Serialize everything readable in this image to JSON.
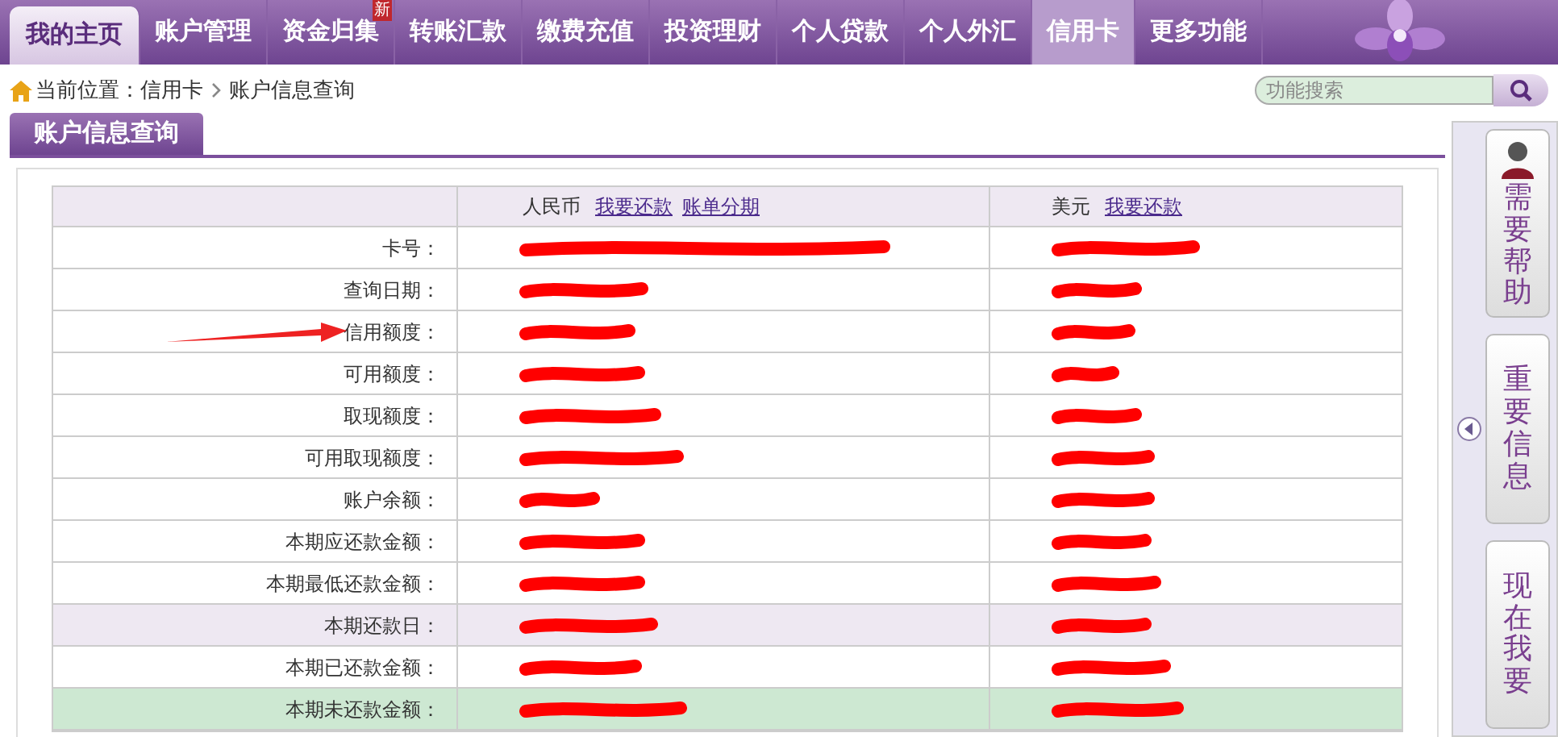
{
  "nav": [
    {
      "label": "我的主页",
      "kind": "home",
      "selected": false
    },
    {
      "label": "账户管理",
      "kind": "tab",
      "selected": false
    },
    {
      "label": "资金归集",
      "kind": "tab",
      "selected": false,
      "badge": "新"
    },
    {
      "label": "转账汇款",
      "kind": "tab",
      "selected": false
    },
    {
      "label": "缴费充值",
      "kind": "tab",
      "selected": false
    },
    {
      "label": "投资理财",
      "kind": "tab",
      "selected": false
    },
    {
      "label": "个人贷款",
      "kind": "tab",
      "selected": false
    },
    {
      "label": "个人外汇",
      "kind": "tab",
      "selected": false
    },
    {
      "label": "信用卡",
      "kind": "tab",
      "selected": true
    },
    {
      "label": "更多功能",
      "kind": "tab",
      "selected": false
    }
  ],
  "breadcrumb": {
    "prefix": "当前位置：",
    "items": [
      "信用卡",
      "账户信息查询"
    ]
  },
  "search": {
    "placeholder": "功能搜索"
  },
  "page_tab": "账户信息查询",
  "table": {
    "columns": [
      {
        "currency": "人民币",
        "links": [
          "我要还款",
          "账单分期"
        ]
      },
      {
        "currency": "美元",
        "links": [
          "我要还款"
        ]
      }
    ],
    "rows": [
      {
        "label": "卡号：",
        "shaded": false,
        "hovered": false,
        "arrow": false
      },
      {
        "label": "查询日期：",
        "shaded": false,
        "hovered": false,
        "arrow": false
      },
      {
        "label": "信用额度：",
        "shaded": false,
        "hovered": false,
        "arrow": true
      },
      {
        "label": "可用额度：",
        "shaded": false,
        "hovered": false,
        "arrow": false
      },
      {
        "label": "取现额度：",
        "shaded": false,
        "hovered": false,
        "arrow": false
      },
      {
        "label": "可用取现额度：",
        "shaded": false,
        "hovered": false,
        "arrow": false
      },
      {
        "label": "账户余额：",
        "shaded": false,
        "hovered": false,
        "arrow": false
      },
      {
        "label": "本期应还款金额：",
        "shaded": false,
        "hovered": false,
        "arrow": false
      },
      {
        "label": "本期最低还款金额：",
        "shaded": false,
        "hovered": false,
        "arrow": false
      },
      {
        "label": "本期还款日：",
        "shaded": true,
        "hovered": false,
        "arrow": false
      },
      {
        "label": "本期已还款金额：",
        "shaded": false,
        "hovered": false,
        "arrow": false
      },
      {
        "label": "本期未还款金额：",
        "shaded": false,
        "hovered": true,
        "arrow": false
      }
    ]
  },
  "side_buttons": [
    {
      "label": "需要帮助",
      "avatar": true
    },
    {
      "label": "重要信息",
      "avatar": false
    },
    {
      "label": "现在我要",
      "avatar": false
    }
  ]
}
